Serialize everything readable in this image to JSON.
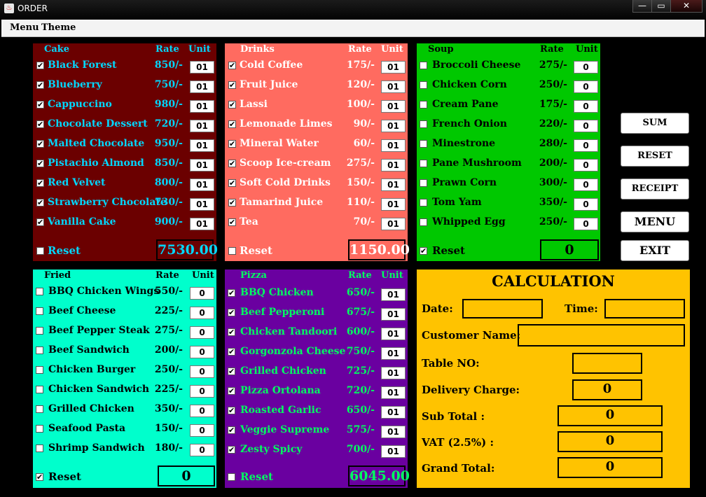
{
  "window": {
    "title": "ORDER",
    "minimize": "—",
    "maximize": "▭",
    "close": "✕"
  },
  "menubar": {
    "menu": "Menu",
    "theme": "Theme"
  },
  "rate_label": "Rate",
  "unit_label": "Unit",
  "reset_label": "Reset",
  "colors": {
    "cake": "#6b0000",
    "drinks": "#ff6b60",
    "soup": "#00c800",
    "fried": "#00ffcc",
    "pizza": "#6a00a0",
    "calc": "#ffc300",
    "accent_text": "#00d8ff"
  },
  "cake": {
    "header": "Cake",
    "items": [
      {
        "name": "Black Forest",
        "rate": "850/-",
        "unit": "01",
        "checked": true
      },
      {
        "name": "Blueberry",
        "rate": "750/-",
        "unit": "01",
        "checked": true
      },
      {
        "name": "Cappuccino",
        "rate": "980/-",
        "unit": "01",
        "checked": true
      },
      {
        "name": "Chocolate Dessert",
        "rate": "720/-",
        "unit": "01",
        "checked": true
      },
      {
        "name": "Malted Chocolate",
        "rate": "950/-",
        "unit": "01",
        "checked": true
      },
      {
        "name": "Pistachio Almond",
        "rate": "850/-",
        "unit": "01",
        "checked": true
      },
      {
        "name": "Red Velvet",
        "rate": "800/-",
        "unit": "01",
        "checked": true
      },
      {
        "name": "Strawberry Chocolate",
        "rate": "730/-",
        "unit": "01",
        "checked": true
      },
      {
        "name": "Vanilla Cake",
        "rate": "900/-",
        "unit": "01",
        "checked": true
      }
    ],
    "reset_checked": false,
    "total": "7530.00"
  },
  "drinks": {
    "header": "Drinks",
    "items": [
      {
        "name": "Cold Coffee",
        "rate": "175/-",
        "unit": "01",
        "checked": true
      },
      {
        "name": "Fruit Juice",
        "rate": "120/-",
        "unit": "01",
        "checked": true
      },
      {
        "name": "Lassi",
        "rate": "100/-",
        "unit": "01",
        "checked": true
      },
      {
        "name": "Lemonade Limes",
        "rate": "90/-",
        "unit": "01",
        "checked": true
      },
      {
        "name": "Mineral Water",
        "rate": "60/-",
        "unit": "01",
        "checked": true
      },
      {
        "name": "Scoop Ice-cream",
        "rate": "275/-",
        "unit": "01",
        "checked": true
      },
      {
        "name": "Soft Cold Drinks",
        "rate": "150/-",
        "unit": "01",
        "checked": true
      },
      {
        "name": "Tamarind Juice",
        "rate": "110/-",
        "unit": "01",
        "checked": true
      },
      {
        "name": "Tea",
        "rate": "70/-",
        "unit": "01",
        "checked": true
      }
    ],
    "reset_checked": false,
    "total": "1150.00"
  },
  "soup": {
    "header": "Soup",
    "items": [
      {
        "name": "Broccoli Cheese",
        "rate": "275/-",
        "unit": "0",
        "checked": false
      },
      {
        "name": "Chicken Corn",
        "rate": "250/-",
        "unit": "0",
        "checked": false
      },
      {
        "name": "Cream Pane",
        "rate": "175/-",
        "unit": "0",
        "checked": false
      },
      {
        "name": "French Onion",
        "rate": "220/-",
        "unit": "0",
        "checked": false
      },
      {
        "name": "Minestrone",
        "rate": "280/-",
        "unit": "0",
        "checked": false
      },
      {
        "name": "Pane Mushroom",
        "rate": "200/-",
        "unit": "0",
        "checked": false
      },
      {
        "name": "Prawn Corn",
        "rate": "300/-",
        "unit": "0",
        "checked": false
      },
      {
        "name": "Tom Yam",
        "rate": "350/-",
        "unit": "0",
        "checked": false
      },
      {
        "name": "Whipped Egg",
        "rate": "250/-",
        "unit": "0",
        "checked": false
      }
    ],
    "reset_checked": true,
    "total": "0"
  },
  "fried": {
    "header": "Fried",
    "items": [
      {
        "name": "BBQ Chicken Wings",
        "rate": "550/-",
        "unit": "0",
        "checked": false
      },
      {
        "name": "Beef Cheese",
        "rate": "225/-",
        "unit": "0",
        "checked": false
      },
      {
        "name": "Beef Pepper Steak",
        "rate": "275/-",
        "unit": "0",
        "checked": false
      },
      {
        "name": "Beef Sandwich",
        "rate": "200/-",
        "unit": "0",
        "checked": false
      },
      {
        "name": "Chicken Burger",
        "rate": "250/-",
        "unit": "0",
        "checked": false
      },
      {
        "name": "Chicken Sandwich",
        "rate": "225/-",
        "unit": "0",
        "checked": false
      },
      {
        "name": "Grilled Chicken",
        "rate": "350/-",
        "unit": "0",
        "checked": false
      },
      {
        "name": "Seafood Pasta",
        "rate": "150/-",
        "unit": "0",
        "checked": false
      },
      {
        "name": "Shrimp Sandwich",
        "rate": "180/-",
        "unit": "0",
        "checked": false
      }
    ],
    "reset_checked": true,
    "total": "0"
  },
  "pizza": {
    "header": "Pizza",
    "items": [
      {
        "name": "BBQ Chicken",
        "rate": "650/-",
        "unit": "01",
        "checked": true
      },
      {
        "name": "Beef Pepperoni",
        "rate": "675/-",
        "unit": "01",
        "checked": true
      },
      {
        "name": "Chicken Tandoori",
        "rate": "600/-",
        "unit": "01",
        "checked": true
      },
      {
        "name": "Gorgonzola Cheese",
        "rate": "750/-",
        "unit": "01",
        "checked": true
      },
      {
        "name": "Grilled Chicken",
        "rate": "725/-",
        "unit": "01",
        "checked": true
      },
      {
        "name": "Pizza Ortolana",
        "rate": "720/-",
        "unit": "01",
        "checked": true
      },
      {
        "name": "Roasted Garlic",
        "rate": "650/-",
        "unit": "01",
        "checked": true
      },
      {
        "name": "Veggie Supreme",
        "rate": "575/-",
        "unit": "01",
        "checked": true
      },
      {
        "name": "Zesty Spicy",
        "rate": "700/-",
        "unit": "01",
        "checked": true
      }
    ],
    "reset_checked": false,
    "total": "6045.00"
  },
  "actions": {
    "sum": "SUM",
    "reset": "RESET",
    "receipt": "RECEIPT",
    "menu": "MENU",
    "exit": "EXIT"
  },
  "calculation": {
    "title": "CALCULATION",
    "date_label": "Date:",
    "date_value": "",
    "time_label": "Time:",
    "time_value": "",
    "customer_label": "Customer Name:",
    "customer_value": "",
    "table_label": "Table NO:",
    "table_value": "",
    "delivery_label": "Delivery Charge:",
    "delivery_value": "0",
    "subtotal_label": "Sub Total :",
    "subtotal_value": "0",
    "vat_label": "VAT (2.5%) :",
    "vat_value": "0",
    "grand_label": "Grand Total:",
    "grand_value": "0"
  }
}
